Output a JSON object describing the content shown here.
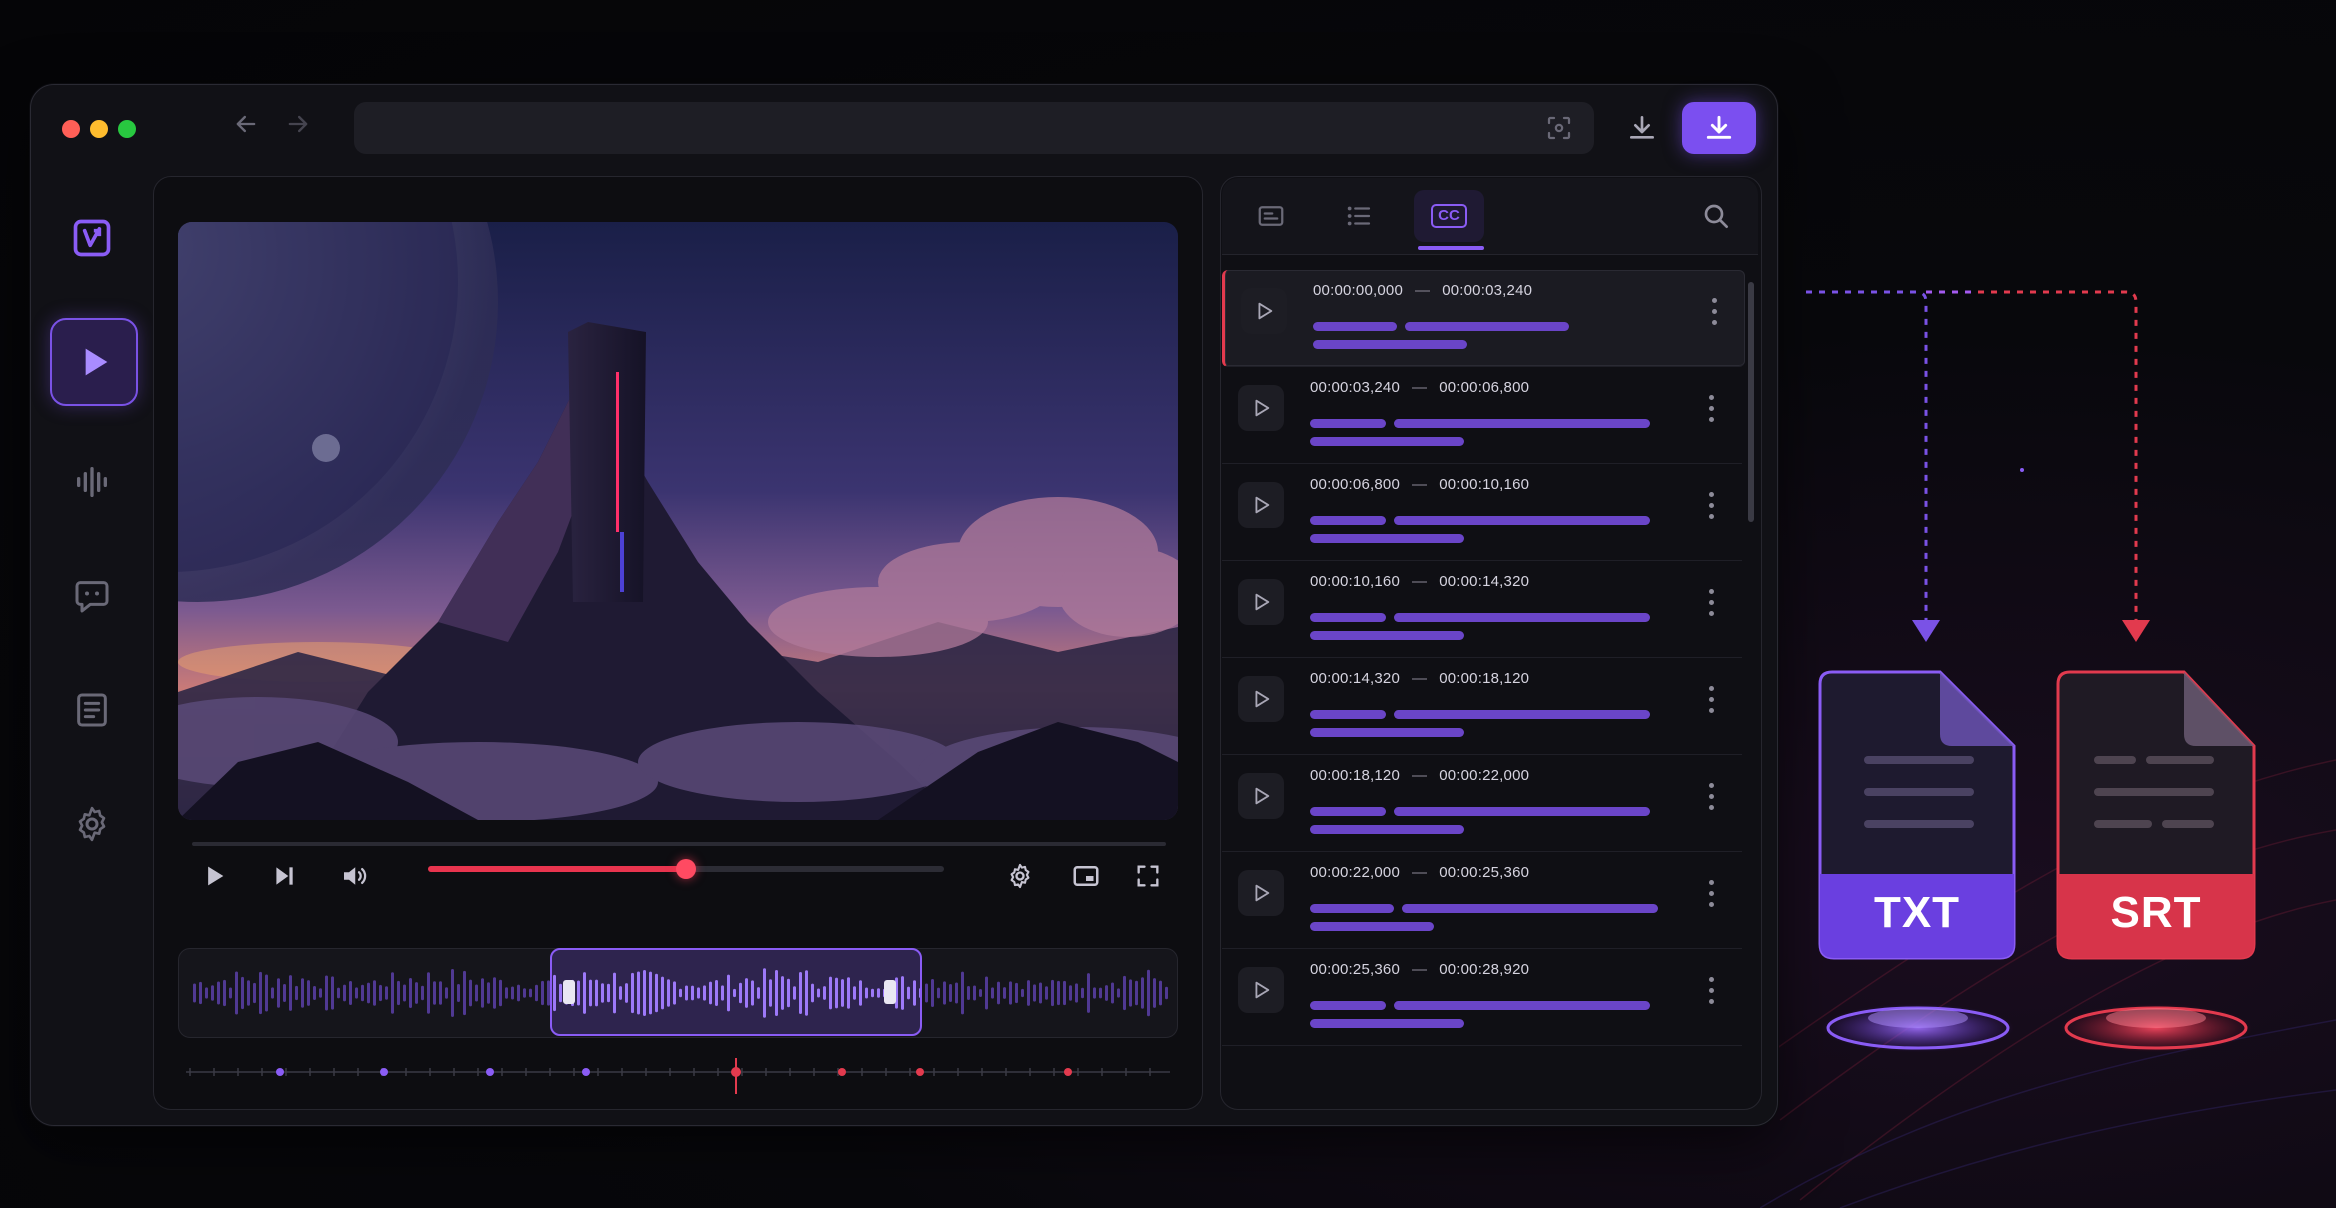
{
  "app": {
    "colors": {
      "accent": "#7a52e6",
      "red": "#e23a4e",
      "panel": "#111116"
    }
  },
  "window_controls": {
    "back_icon": "arrow-left-icon",
    "forward_icon": "arrow-right-icon"
  },
  "sidebar": {
    "items": [
      {
        "name": "logo",
        "icon": "logo-icon"
      },
      {
        "name": "player",
        "icon": "play-icon",
        "active": true
      },
      {
        "name": "audio",
        "icon": "waveform-icon"
      },
      {
        "name": "chat",
        "icon": "chat-icon"
      },
      {
        "name": "transcript",
        "icon": "document-list-icon"
      },
      {
        "name": "settings",
        "icon": "gear-icon"
      }
    ]
  },
  "player": {
    "progress": 0.5
  },
  "subtitle_tabs": [
    {
      "icon": "caption-box-icon"
    },
    {
      "icon": "list-icon"
    },
    {
      "icon": "cc-icon",
      "label": "CC",
      "active": true
    }
  ],
  "subtitles": [
    {
      "start": "00:00:00,000",
      "end": "00:00:03,240"
    },
    {
      "start": "00:00:03,240",
      "end": "00:00:06,800"
    },
    {
      "start": "00:00:06,800",
      "end": "00:00:10,160"
    },
    {
      "start": "00:00:10,160",
      "end": "00:00:14,320"
    },
    {
      "start": "00:00:14,320",
      "end": "00:00:18,120"
    },
    {
      "start": "00:00:18,120",
      "end": "00:00:22,000"
    },
    {
      "start": "00:00:22,000",
      "end": "00:00:25,360"
    },
    {
      "start": "00:00:25,360",
      "end": "00:00:28,920"
    }
  ],
  "exports": {
    "txt_label": "TXT",
    "srt_label": "SRT"
  }
}
